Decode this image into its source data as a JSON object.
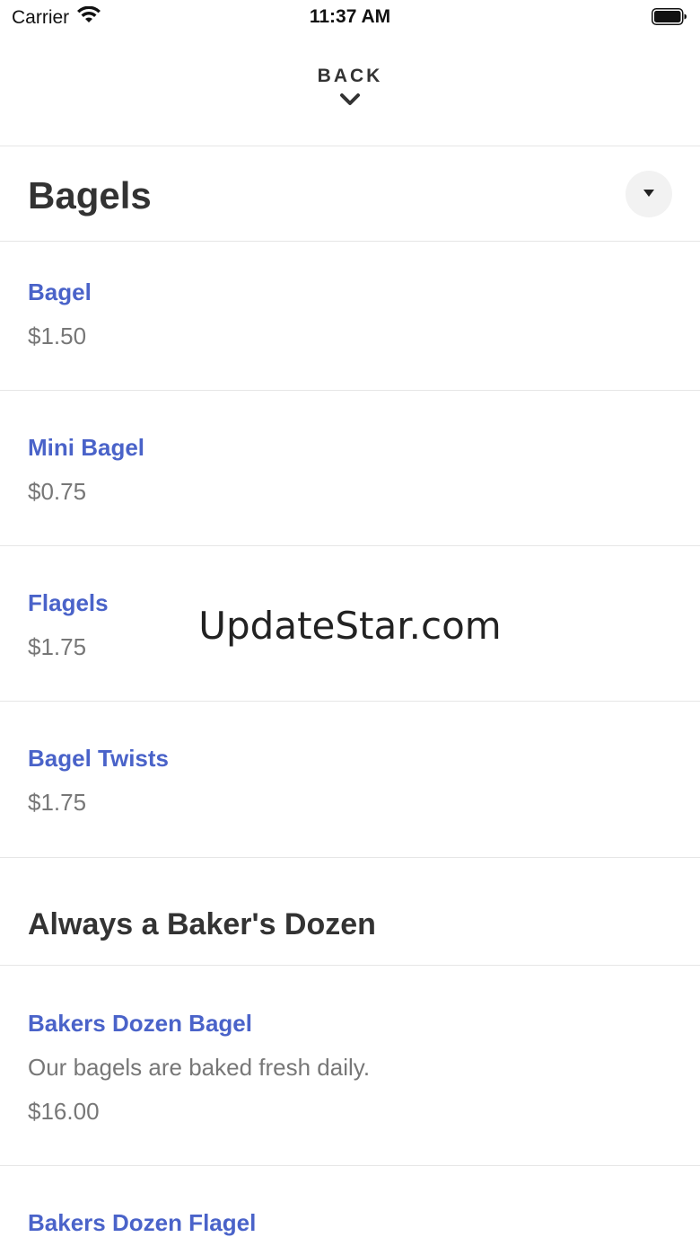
{
  "status_bar": {
    "carrier": "Carrier",
    "time": "11:37 AM"
  },
  "nav": {
    "back_label": "BACK"
  },
  "category": {
    "title": "Bagels"
  },
  "items": [
    {
      "name": "Bagel",
      "price": "$1.50"
    },
    {
      "name": "Mini Bagel",
      "price": "$0.75"
    },
    {
      "name": "Flagels",
      "price": "$1.75"
    },
    {
      "name": "Bagel Twists",
      "price": "$1.75"
    }
  ],
  "section": {
    "title": "Always a Baker's Dozen"
  },
  "section_items": [
    {
      "name": "Bakers Dozen Bagel",
      "description": "Our bagels are baked fresh daily.",
      "price": "$16.00"
    },
    {
      "name": "Bakers Dozen Flagel"
    }
  ],
  "watermark": "UpdateStar.com",
  "colors": {
    "item_name": "#4a63c9",
    "muted_text": "#777777",
    "heading": "#333333",
    "divider": "#e6e6e6"
  },
  "icons": {
    "wifi": "wifi-icon",
    "battery": "battery-icon",
    "back": "chevron-down-icon",
    "dropdown": "caret-down-icon"
  }
}
